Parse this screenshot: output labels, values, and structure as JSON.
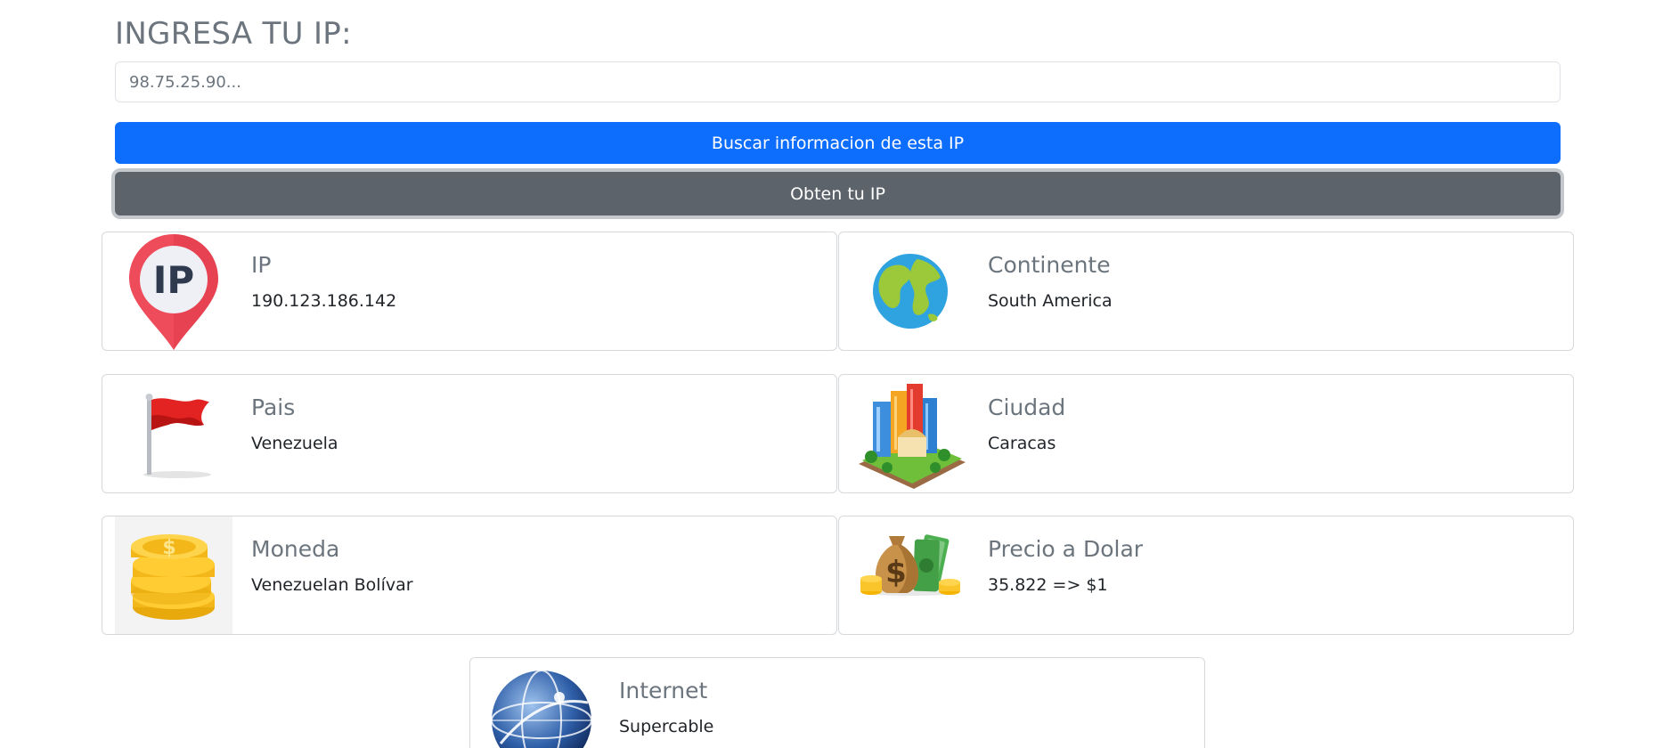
{
  "header": {
    "title": "INGRESA TU IP:"
  },
  "search": {
    "placeholder": "98.75.25.90..."
  },
  "buttons": {
    "search_label": "Buscar informacion de esta IP",
    "get_ip_label": "Obten tu IP"
  },
  "cards": [
    {
      "title": "IP",
      "value": "190.123.186.142",
      "icon": "ip-location-pin-icon"
    },
    {
      "title": "Continente",
      "value": "South America",
      "icon": "globe-icon"
    },
    {
      "title": "Pais",
      "value": "Venezuela",
      "icon": "red-flag-icon"
    },
    {
      "title": "Ciudad",
      "value": "Caracas",
      "icon": "city-buildings-icon"
    },
    {
      "title": "Moneda",
      "value": "Venezuelan Bolívar",
      "icon": "gold-coins-icon"
    },
    {
      "title": "Precio a Dolar",
      "value": "35.822 => $1",
      "icon": "money-bag-icon"
    },
    {
      "title": "Internet",
      "value": "Supercable",
      "icon": "internet-globe-icon"
    }
  ],
  "colors": {
    "primary": "#0d6efd",
    "secondary": "#5c636a",
    "muted_text": "#6c757d",
    "pin_red": "#ee4c5a"
  },
  "ip_pin_text": "IP"
}
